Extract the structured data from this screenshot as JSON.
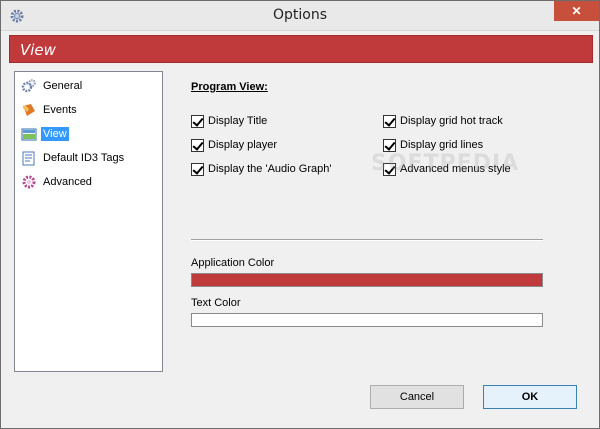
{
  "window": {
    "title": "Options",
    "close_glyph": "✕"
  },
  "banner": {
    "title": "View",
    "color": "#c0393b"
  },
  "nav": {
    "items": [
      {
        "label": "General",
        "icon": "gear-icon",
        "selected": false
      },
      {
        "label": "Events",
        "icon": "events-icon",
        "selected": false
      },
      {
        "label": "View",
        "icon": "view-icon",
        "selected": true
      },
      {
        "label": "Default ID3 Tags",
        "icon": "tags-icon",
        "selected": false
      },
      {
        "label": "Advanced",
        "icon": "advanced-icon",
        "selected": false
      }
    ]
  },
  "program_view": {
    "title": "Program View:",
    "left": [
      {
        "label": "Display Title",
        "checked": true
      },
      {
        "label": "Display player",
        "checked": true
      },
      {
        "label": "Display the 'Audio Graph'",
        "checked": true
      }
    ],
    "right": [
      {
        "label": "Display grid hot track",
        "checked": true
      },
      {
        "label": "Display grid lines",
        "checked": true
      },
      {
        "label": "Advanced menus style",
        "checked": true
      }
    ]
  },
  "colors": {
    "application_label": "Application Color",
    "application_value": "#c0393b",
    "text_label": "Text Color",
    "text_value": "#ffffff"
  },
  "watermark": "SOFTPEDIA",
  "buttons": {
    "cancel": "Cancel",
    "ok": "OK"
  }
}
